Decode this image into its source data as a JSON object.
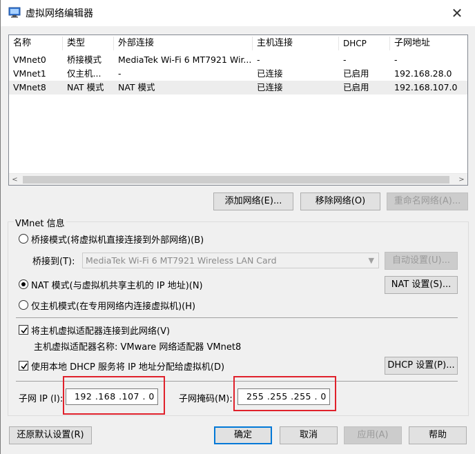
{
  "window": {
    "title": "虚拟网络编辑器",
    "close_glyph": "✕"
  },
  "table": {
    "headers": [
      "名称",
      "类型",
      "外部连接",
      "主机连接",
      "DHCP",
      "子网地址"
    ],
    "rows": [
      {
        "name": "VMnet0",
        "type": "桥接模式",
        "external": "MediaTek Wi-Fi 6 MT7921 Wir...",
        "host": "-",
        "dhcp": "-",
        "subnet": "-"
      },
      {
        "name": "VMnet1",
        "type": "仅主机...",
        "external": "-",
        "host": "已连接",
        "dhcp": "已启用",
        "subnet": "192.168.28.0"
      },
      {
        "name": "VMnet8",
        "type": "NAT 模式",
        "external": "NAT 模式",
        "host": "已连接",
        "dhcp": "已启用",
        "subnet": "192.168.107.0"
      }
    ],
    "scroll_left": "<",
    "scroll_right": ">"
  },
  "buttons": {
    "add_network": "添加网络(E)...",
    "remove_network": "移除网络(O)",
    "rename_network": "重命名网络(A)..."
  },
  "vmnet_info": {
    "group_label": "VMnet 信息",
    "bridged_label": "桥接模式(将虚拟机直接连接到外部网络)(B)",
    "bridge_to_label": "桥接到(T):",
    "bridge_to_value": "MediaTek Wi-Fi 6 MT7921 Wireless LAN Card",
    "auto_settings": "自动设置(U)...",
    "nat_label": "NAT 模式(与虚拟机共享主机的 IP 地址)(N)",
    "nat_settings": "NAT 设置(S)...",
    "host_only_label": "仅主机模式(在专用网络内连接虚拟机)(H)",
    "connect_adapter_label": "将主机虚拟适配器连接到此网络(V)",
    "adapter_name_label": "主机虚拟适配器名称: VMware 网络适配器 VMnet8",
    "dhcp_label": "使用本地 DHCP 服务将 IP 地址分配给虚拟机(D)",
    "dhcp_settings": "DHCP 设置(P)...",
    "subnet_ip_label": "子网 IP (I):",
    "subnet_ip_value": "192 .168 .107 .  0",
    "subnet_mask_label": "子网掩码(M):",
    "subnet_mask_value": "255 .255 .255 .  0"
  },
  "footer": {
    "restore_defaults": "还原默认设置(R)",
    "ok": "确定",
    "cancel": "取消",
    "apply": "应用(A)",
    "help": "帮助"
  },
  "colors": {
    "highlight_box": "#e0202a",
    "default_button_border": "#0078d7"
  }
}
